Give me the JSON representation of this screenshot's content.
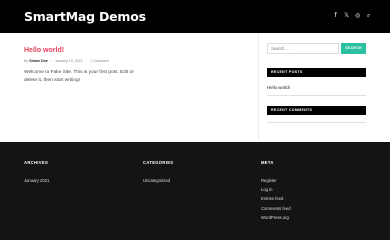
{
  "header": {
    "site_title": "SmartMag Demos",
    "social_icons": [
      "facebook-icon",
      "twitter-icon",
      "instagram-icon",
      "search-icon"
    ]
  },
  "post": {
    "title": "Hello world!",
    "author_prefix": "By",
    "author": "Shane Doe",
    "date": "January 19, 2021",
    "comments": "1 Comment",
    "excerpt": "Welcome to Fake Site. This is your first post. Edit or delete it, then start writing!"
  },
  "sidebar": {
    "search_placeholder": "Search ...",
    "search_button": "SEARCH",
    "recent_posts_heading": "RECENT POSTS",
    "recent_posts": [
      "Hello world!"
    ],
    "recent_comments_heading": "RECENT COMMENTS"
  },
  "footer": {
    "archives_heading": "ARCHIVES",
    "archives": [
      "January 2021"
    ],
    "categories_heading": "CATEGORIES",
    "categories": [
      "Uncategorized"
    ],
    "meta_heading": "META",
    "meta_links": [
      "Register",
      "Log in",
      "Entries feed",
      "Comments feed",
      "WordPress.org"
    ]
  }
}
